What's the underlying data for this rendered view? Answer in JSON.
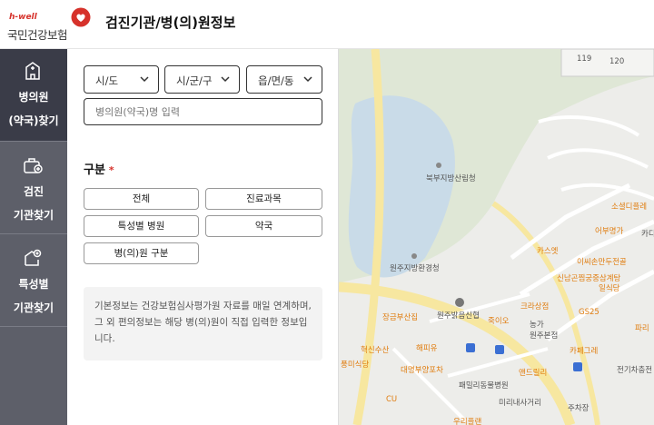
{
  "header": {
    "logo_brand": "h-well",
    "logo_name": "국민건강보험",
    "title": "검진기관/병(의)원정보"
  },
  "sidebar": {
    "items": [
      {
        "line1": "병의원",
        "line2": "(약국)찾기",
        "icon": "hospital-building-icon",
        "active": true
      },
      {
        "line1": "검진",
        "line2": "기관찾기",
        "icon": "medical-bag-icon",
        "active": false
      },
      {
        "line1": "특성별",
        "line2": "기관찾기",
        "icon": "clinic-plus-icon",
        "active": false
      }
    ]
  },
  "filters": {
    "province": "시/도",
    "city": "시/군/구",
    "town": "읍/면/동",
    "search_placeholder": "병의원(약국)명 입력"
  },
  "category": {
    "title": "구분",
    "required_mark": "*",
    "chips": [
      "전체",
      "진료과목",
      "특성별 병원",
      "약국",
      "병(의)원 구분"
    ]
  },
  "info_text": "기본정보는 건강보험심사평가원 자료를 매일 연계하며, 그 외 편의정보는 해당 병(의)원이 직접 입력한 정보입니다.",
  "map": {
    "road_numbers": [
      "119",
      "120"
    ],
    "places": [
      "북부지방산림청",
      "원주지방환경청",
      "원주밝음신협",
      "소셜디플레",
      "카스엣",
      "어부명가",
      "이씨손만두전골",
      "신남곤찜궁중삼계탕",
      "크라상점",
      "일식당",
      "GS25",
      "농가",
      "원주본점",
      "카페그레",
      "죽이오",
      "전기차충전",
      "앤드릴리",
      "미리내사거리",
      "주차장",
      "해피유",
      "무한한",
      "대명부양포차",
      "우리플랜",
      "패밀리동물병원",
      "CU",
      "혁신수산",
      "장금부산집",
      "풍미식당",
      "카디",
      "파리"
    ]
  },
  "colors": {
    "sidebar_bg": "#5d5f69",
    "sidebar_active": "#3a3c48",
    "brand_red": "#d6322b",
    "main_road": "#f7e7a0",
    "water": "#c9dbe8"
  }
}
